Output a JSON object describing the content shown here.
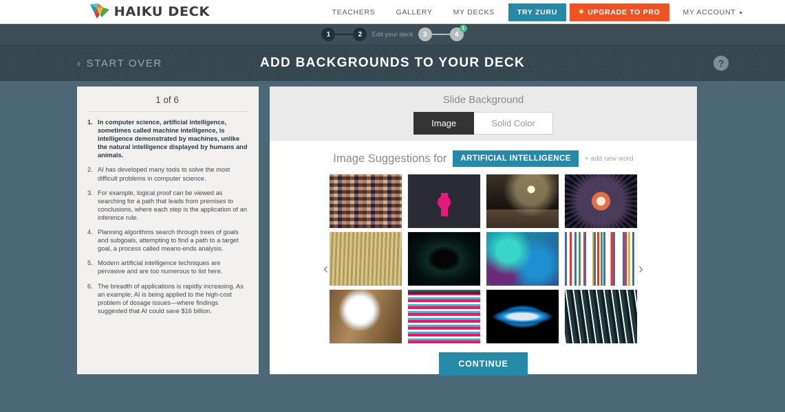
{
  "topnav": {
    "logo_text": "HAIKU DECK",
    "logo_icon": "origami-bird-logo",
    "links": [
      {
        "label": "TEACHERS"
      },
      {
        "label": "GALLERY"
      },
      {
        "label": "MY DECKS"
      }
    ],
    "try_zuru_label": "TRY ZURU",
    "upgrade_label": "UPGRADE TO PRO",
    "upgrade_icon": "sun-star-icon",
    "account_label": "MY ACCOUNT",
    "account_caret_icon": "chevron-down-icon",
    "teal": "#2789a8",
    "orange": "#ef5323"
  },
  "stepbar": {
    "steps": [
      {
        "number": "1",
        "state": "done"
      },
      {
        "number": "2",
        "state": "done"
      },
      {
        "number": "3",
        "state": "todo"
      },
      {
        "number": "4",
        "state": "todo",
        "badge": "1"
      }
    ],
    "middle_label": "Edit your deck",
    "badge_color": "#3fbf8f"
  },
  "pagehead": {
    "start_over": "START OVER",
    "back_icon": "chevron-left-icon",
    "title": "ADD BACKGROUNDS TO YOUR DECK",
    "help_icon": "question-mark-icon",
    "help_glyph": "?"
  },
  "sidebar": {
    "slide_count": "1 of 6",
    "bullets": [
      {
        "text": "In computer science, artificial intelligence, sometimes called machine intelligence, is intelligence demonstrated by machines, unlike the natural intelligence displayed by humans and animals.",
        "active": true
      },
      {
        "text": "AI has developed many tools to solve the most difficult problems in computer science.",
        "active": false
      },
      {
        "text": "For example, logical proof can be viewed as searching for a path that leads from premises to conclusions, where each step is the application of an inference rule.",
        "active": false
      },
      {
        "text": "Planning algorithms search through trees of goals and subgoals, attempting to find a path to a target goal, a process called means-ends analysis.",
        "active": false
      },
      {
        "text": "Modern artificial intelligence techniques are pervasive and are too numerous to list here.",
        "active": false
      },
      {
        "text": "The breadth of applications is rapidly increasing. As an example, AI is being applied to the high-cost problem of dosage issues—where findings suggested that AI could save $16 billion.",
        "active": false
      }
    ]
  },
  "main": {
    "panel_title": "Slide Background",
    "toggle": {
      "image_label": "Image",
      "solid_label": "Solid Color",
      "selected": "Image"
    },
    "suggestions_label": "Image Suggestions for",
    "keyword": "ARTIFICIAL INTELLIGENCE",
    "add_word_label": "+ add new word",
    "prev_icon": "chevron-left-icon",
    "next_icon": "chevron-right-icon",
    "prev_glyph": "‹",
    "next_glyph": "›",
    "continue_label": "CONTINUE",
    "thumbnails": [
      {
        "name": "face-mosaic-grid"
      },
      {
        "name": "pink-robot-infographic"
      },
      {
        "name": "toy-robots-dark-room"
      },
      {
        "name": "glowing-orb-starburst"
      },
      {
        "name": "circuit-board-hardware"
      },
      {
        "name": "dark-vortex-help-text"
      },
      {
        "name": "teal-abstract-texture"
      },
      {
        "name": "colorful-circuit-tree"
      },
      {
        "name": "white-pepper-robot"
      },
      {
        "name": "neon-figure-silhouette"
      },
      {
        "name": "blue-eye-light-shape"
      },
      {
        "name": "white-light-streaks"
      }
    ]
  }
}
